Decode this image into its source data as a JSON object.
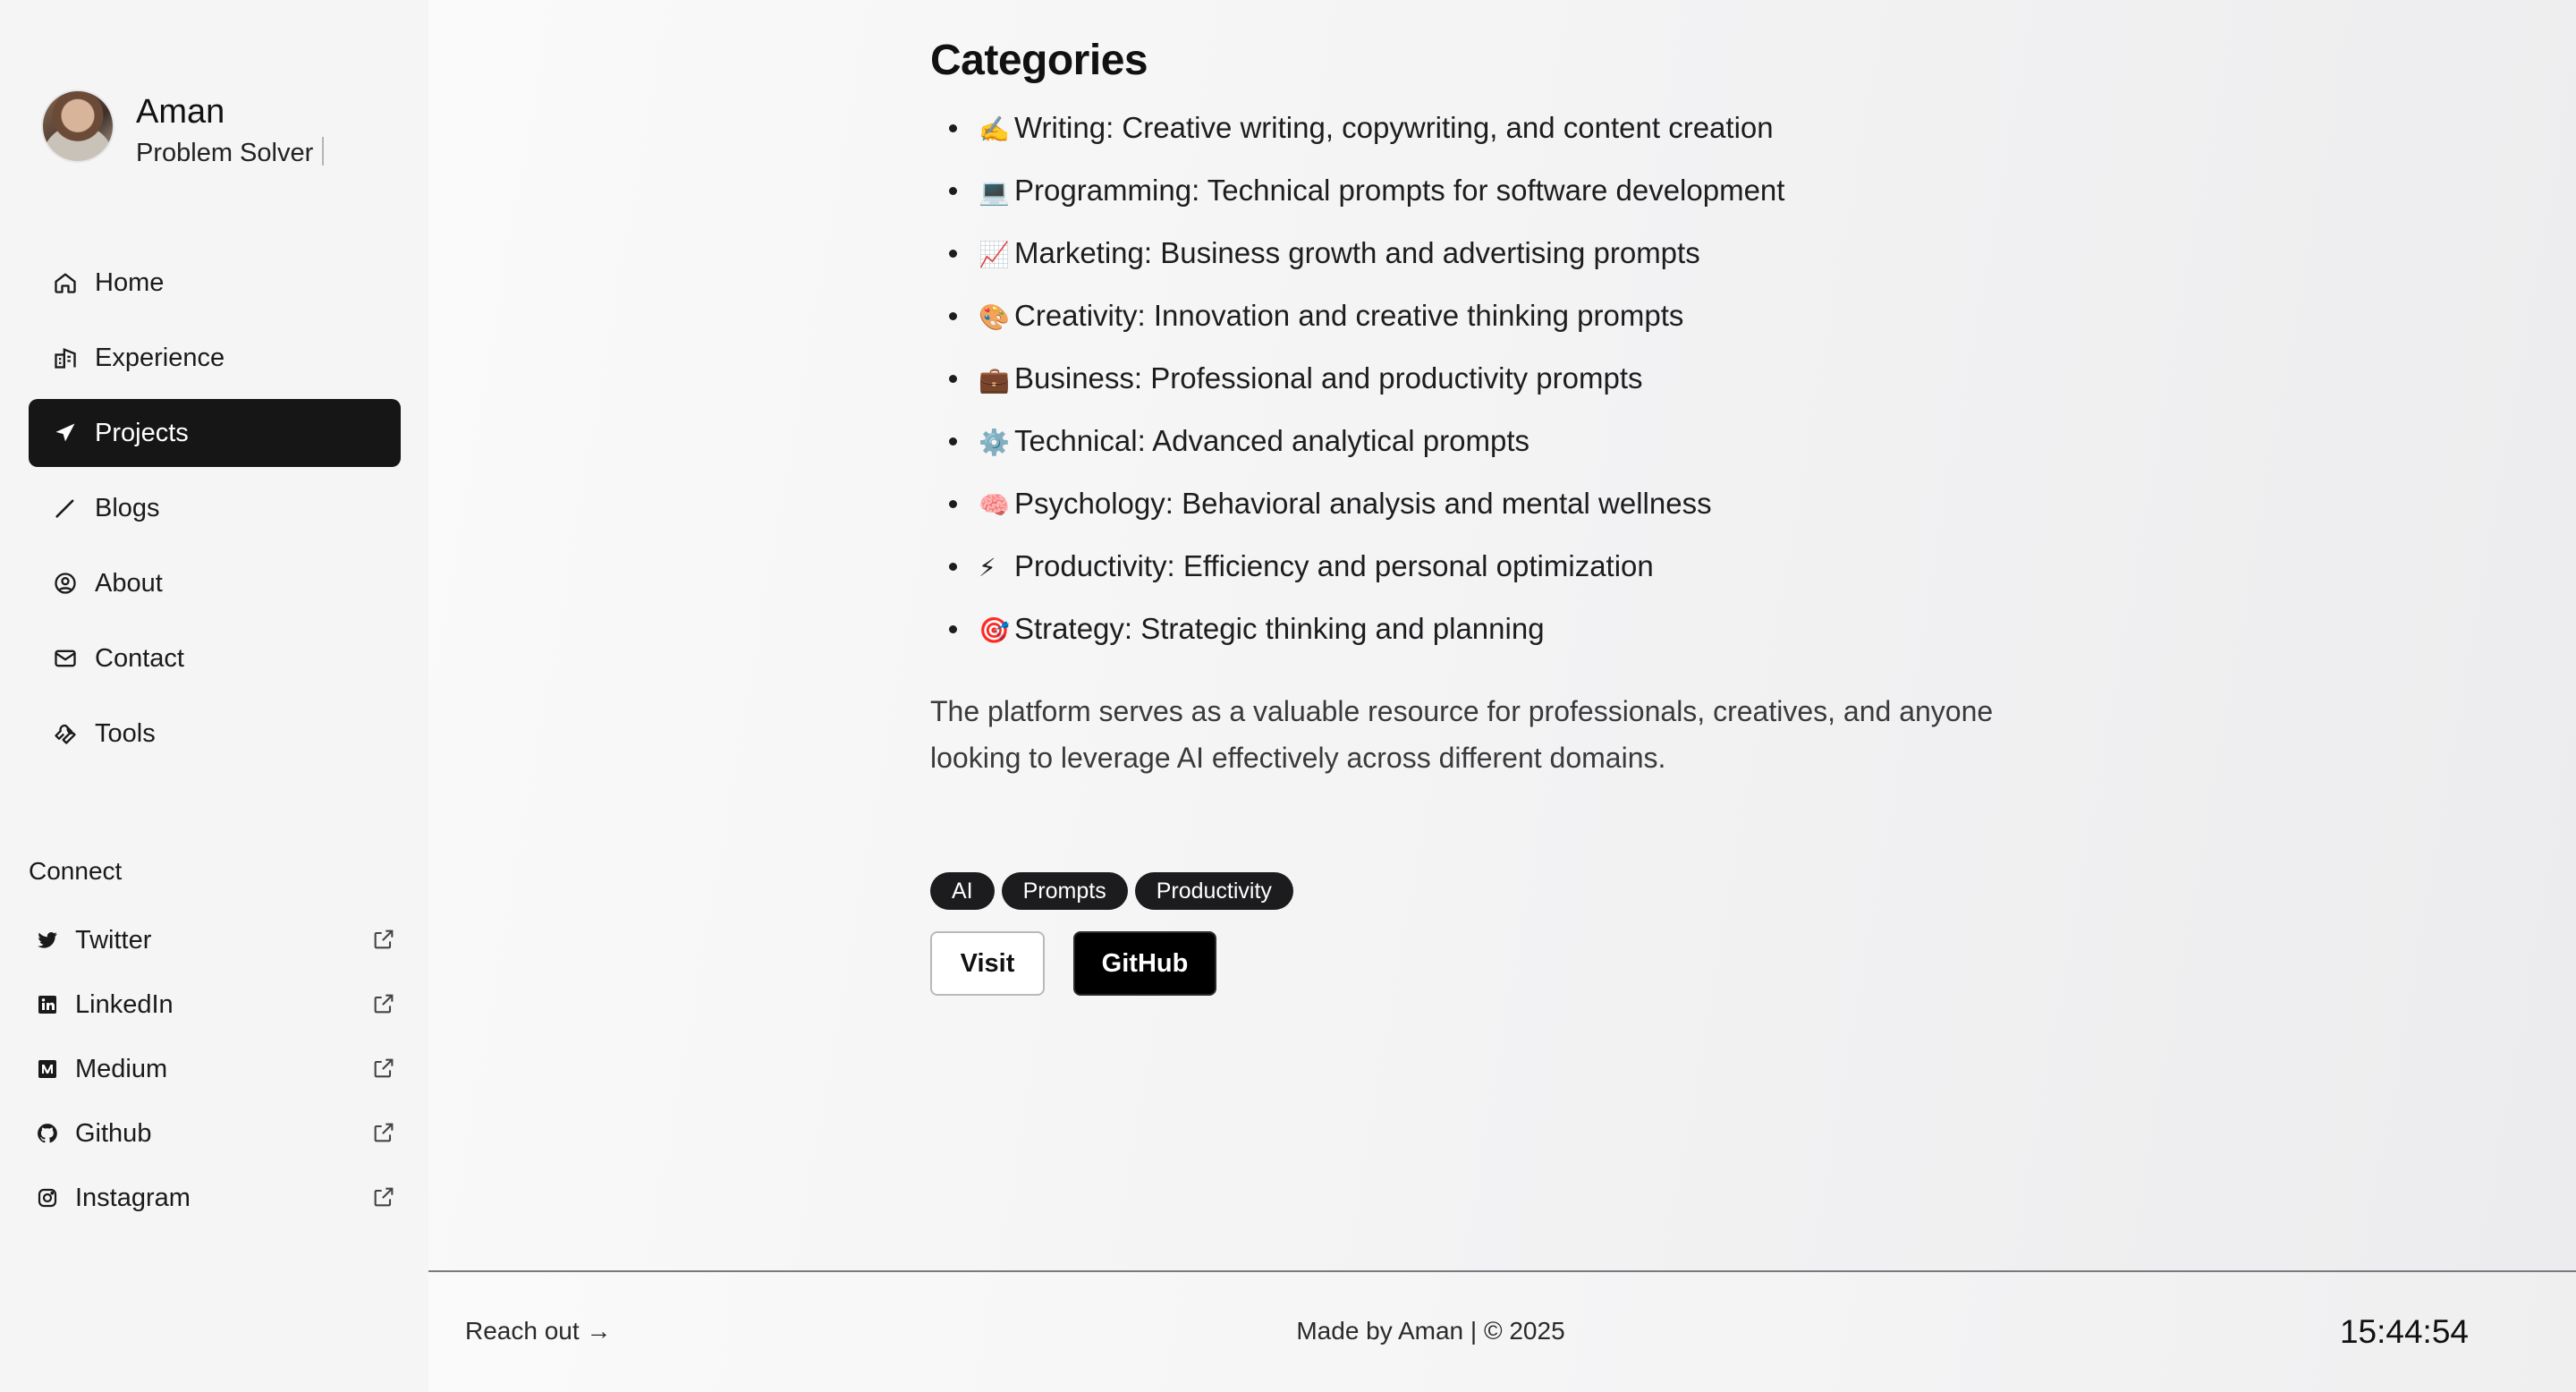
{
  "profile": {
    "name": "Aman",
    "role": "Problem Solver"
  },
  "nav": {
    "items": [
      {
        "label": "Home",
        "icon": "home-icon"
      },
      {
        "label": "Experience",
        "icon": "building-icon"
      },
      {
        "label": "Projects",
        "icon": "send-icon",
        "active": true
      },
      {
        "label": "Blogs",
        "icon": "pen-icon"
      },
      {
        "label": "About",
        "icon": "user-circle-icon"
      },
      {
        "label": "Contact",
        "icon": "mail-icon"
      },
      {
        "label": "Tools",
        "icon": "wrench-icon"
      }
    ]
  },
  "connect": {
    "title": "Connect",
    "items": [
      {
        "label": "Twitter",
        "icon": "twitter-icon"
      },
      {
        "label": "LinkedIn",
        "icon": "linkedin-icon"
      },
      {
        "label": "Medium",
        "icon": "medium-icon"
      },
      {
        "label": "Github",
        "icon": "github-icon"
      },
      {
        "label": "Instagram",
        "icon": "instagram-icon"
      }
    ]
  },
  "main": {
    "title": "Categories",
    "categories": [
      {
        "emoji": "✍️",
        "text": "Writing: Creative writing, copywriting, and content creation"
      },
      {
        "emoji": "💻",
        "text": "Programming: Technical prompts for software development"
      },
      {
        "emoji": "📈",
        "text": "Marketing: Business growth and advertising prompts"
      },
      {
        "emoji": "🎨",
        "text": "Creativity: Innovation and creative thinking prompts"
      },
      {
        "emoji": "💼",
        "text": "Business: Professional and productivity prompts"
      },
      {
        "emoji": "⚙️",
        "text": "Technical: Advanced analytical prompts"
      },
      {
        "emoji": "🧠",
        "text": "Psychology: Behavioral analysis and mental wellness"
      },
      {
        "emoji": "⚡",
        "text": "Productivity: Efficiency and personal optimization"
      },
      {
        "emoji": "🎯",
        "text": "Strategy: Strategic thinking and planning"
      }
    ],
    "description": "The platform serves as a valuable resource for professionals, creatives, and anyone looking to leverage AI effectively across different domains.",
    "tags": [
      "AI",
      "Prompts",
      "Productivity"
    ],
    "visit_label": "Visit",
    "github_label": "GitHub"
  },
  "footer": {
    "reach_out": "Reach out →",
    "made_by": "Made by Aman | © 2025",
    "clock": "15:44:54"
  },
  "colors": {
    "active_nav_bg": "#161616",
    "tag_bg": "#1c1c1e",
    "github_btn_bg": "#000000"
  }
}
